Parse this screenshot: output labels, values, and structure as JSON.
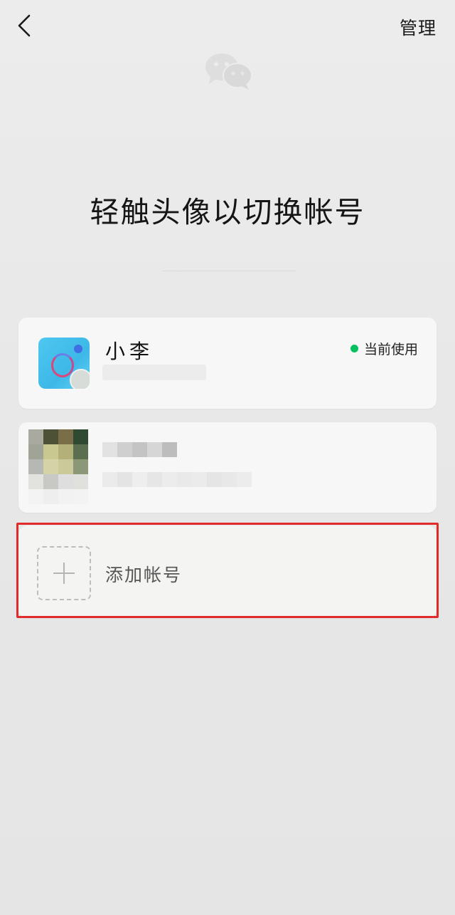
{
  "nav": {
    "back_icon": "chevron-left-icon",
    "manage_label": "管理"
  },
  "logo": {
    "icon": "wechat-logo-icon"
  },
  "headline": "轻触头像以切换帐号",
  "accounts": [
    {
      "name": "小李",
      "status_label": "当前使用",
      "status_color": "#07c160",
      "avatar_color": "#4ec8ef"
    },
    {
      "name": "",
      "status_label": ""
    }
  ],
  "add_account": {
    "label": "添加帐号",
    "icon": "plus-icon"
  },
  "highlight_color": "#e12b2b"
}
